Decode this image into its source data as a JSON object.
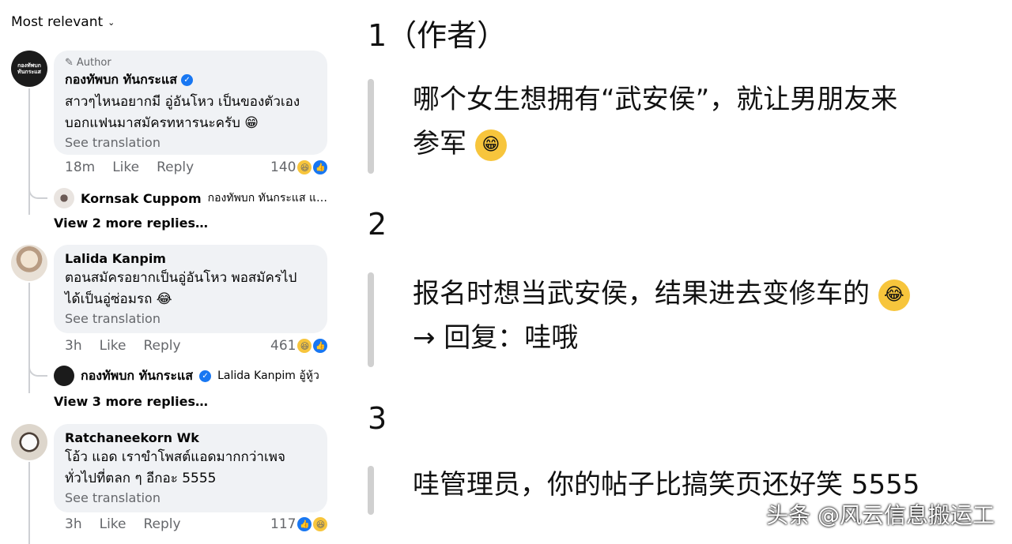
{
  "sort_label": "Most relevant",
  "comments": [
    {
      "author_tag": "Author",
      "name": "กองทัพบก ทันกระแส",
      "verified": true,
      "text_line1": "สาวๆไหนอยากมี อู่อันโหว เป็นของตัวเอง",
      "text_line2": "บอกแฟนมาสมัครทหารนะครับ 😁",
      "see_translation": "See translation",
      "time": "18m",
      "like": "Like",
      "reply": "Reply",
      "reaction_count": "140",
      "sub_reply": {
        "name": "Kornsak Cuppom",
        "text": "กองทัพบก ทันกระแส แล้…"
      },
      "view_more": "View 2 more replies…"
    },
    {
      "name": "Lalida Kanpim",
      "text_line1": "ตอนสมัครอยากเป็นอู่อันโหว พอสมัครไป",
      "text_line2": "ได้เป็นอู่ซ่อมรถ 😂",
      "see_translation": "See translation",
      "time": "3h",
      "like": "Like",
      "reply": "Reply",
      "reaction_count": "461",
      "sub_reply": {
        "name": "กองทัพบก ทันกระแส",
        "text": "Lalida Kanpim อู้หู้ว"
      },
      "view_more": "View 3 more replies…"
    },
    {
      "name": "Ratchaneekorn Wk",
      "text_line1": "โอ้ว แอด เราขำโพสต์แอดมากกว่าเพจ",
      "text_line2": "ทั่วไปที่ตลก ๆ อีกอะ 5555",
      "see_translation": "See translation",
      "time": "3h",
      "like": "Like",
      "reply": "Reply",
      "reaction_count": "117"
    }
  ],
  "translations": [
    {
      "num": "1（作者）",
      "line1": "哪个女生想拥有“武安侯”，就让男朋友来",
      "line2": "参军"
    },
    {
      "num": "2",
      "line1": "报名时想当武安侯，结果进去变修车的",
      "line2": "→ 回复：哇哦"
    },
    {
      "num": "3",
      "line1": "哇管理员，你的帖子比搞笑页还好笑 5555"
    }
  ],
  "watermark": "头条 @风云信息搬运工",
  "avatar_text": "กองทัพบก ทันกระแส",
  "colors": {
    "link_blue": "#1877f2",
    "bubble_bg": "#f0f2f5",
    "muted": "#65676b",
    "haha_yellow": "#f7c53c"
  }
}
